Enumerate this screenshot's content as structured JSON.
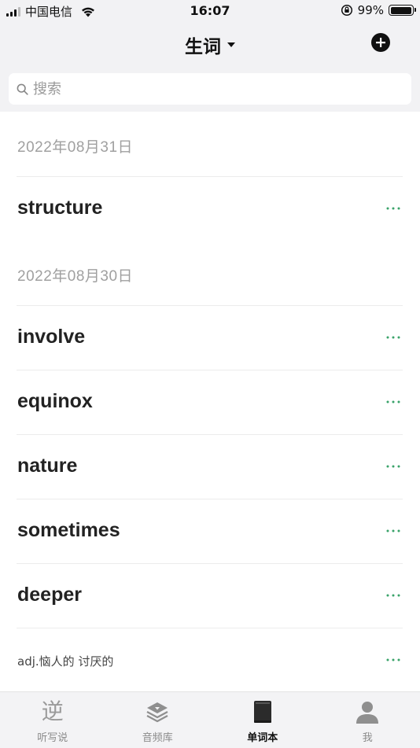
{
  "status_bar": {
    "carrier": "中国电信",
    "time": "16:07",
    "battery_percent": "99%",
    "battery_level": 0.99,
    "signal_bars": 4,
    "signal_active": 3
  },
  "nav": {
    "title": "生词",
    "title_icon": "caret-down-icon",
    "add_icon": "plus-circle-icon"
  },
  "search": {
    "placeholder": "搜索",
    "value": ""
  },
  "list": {
    "groups": [
      {
        "date": "2022年08月31日",
        "words": [
          {
            "text": "structure",
            "type": "word"
          }
        ]
      },
      {
        "date": "2022年08月30日",
        "words": [
          {
            "text": "involve",
            "type": "word"
          },
          {
            "text": "equinox",
            "type": "word"
          },
          {
            "text": "nature",
            "type": "word"
          },
          {
            "text": "sometimes",
            "type": "word"
          },
          {
            "text": "deeper",
            "type": "word"
          },
          {
            "text": "adj.恼人的 讨厌的",
            "type": "meaning"
          }
        ]
      }
    ],
    "more_icon": "ellipsis-icon",
    "more_color": "#3aa36a"
  },
  "tab_bar": {
    "tabs": [
      {
        "label": "听写说",
        "icon": "ni-glyph-icon",
        "glyph": "逆",
        "active": false
      },
      {
        "label": "音频库",
        "icon": "layers-icon",
        "active": false
      },
      {
        "label": "单词本",
        "icon": "notebook-icon",
        "active": true
      },
      {
        "label": "我",
        "icon": "person-icon",
        "active": false
      }
    ]
  }
}
